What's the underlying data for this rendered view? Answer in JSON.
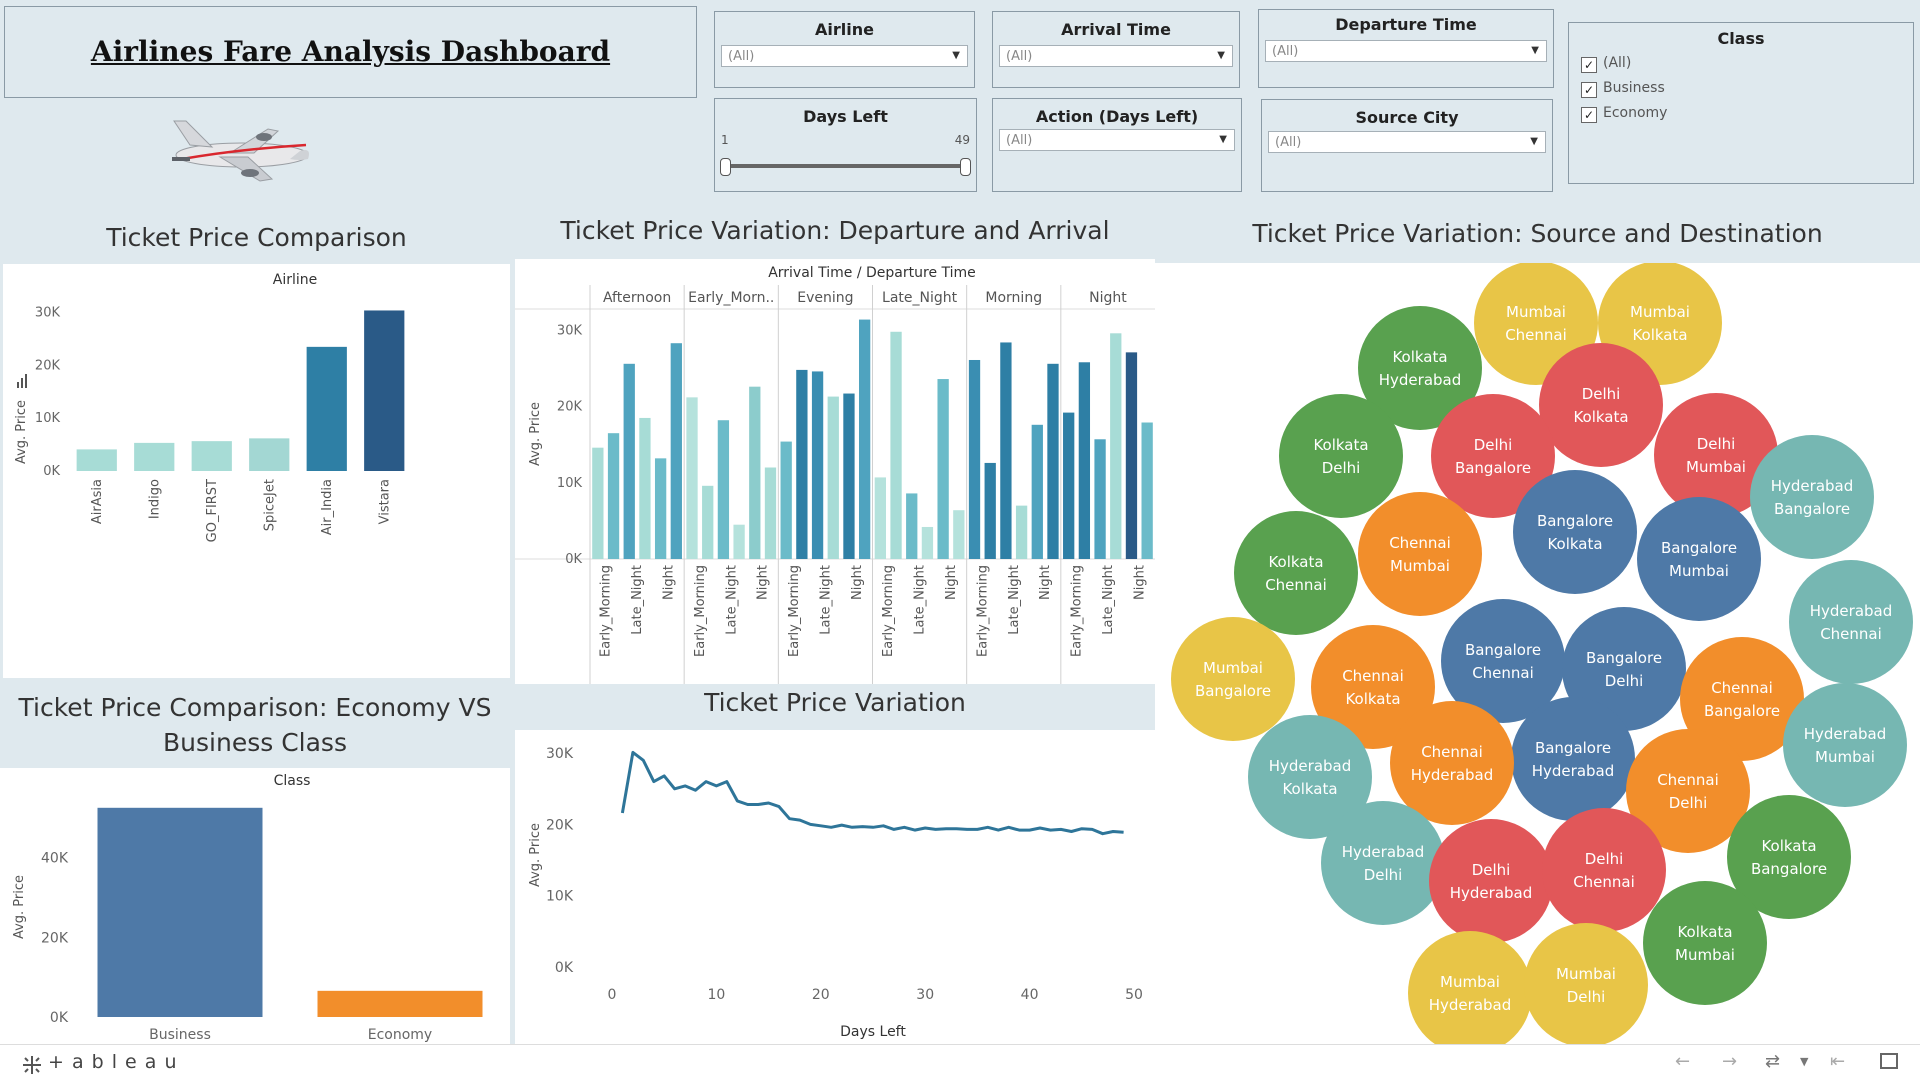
{
  "dashboard": {
    "title": "Airlines Fare Analysis Dashboard"
  },
  "filters": {
    "airline": {
      "label": "Airline",
      "value": "(All)"
    },
    "arrival_time": {
      "label": "Arrival Time",
      "value": "(All)"
    },
    "departure_time": {
      "label": "Departure Time",
      "value": "(All)"
    },
    "days_left": {
      "label": "Days Left",
      "min": "1",
      "max": "49"
    },
    "action_days_left": {
      "label": "Action (Days Left)",
      "value": "(All)"
    },
    "source_city": {
      "label": "Source City",
      "value": "(All)"
    },
    "class": {
      "label": "Class",
      "options": [
        "(All)",
        "Business",
        "Economy"
      ],
      "checked": [
        true,
        true,
        true
      ]
    }
  },
  "icons": {
    "airplane": "airplane-icon",
    "sort": "sort-icon",
    "tableau_logo": "tableau-logo"
  },
  "colors": {
    "background": "#dfe9ee",
    "business": "#4e79a7",
    "economy": "#f28e2b",
    "line": "#2e7599"
  },
  "chart_data": [
    {
      "id": "airline",
      "type": "bar",
      "title": "Ticket Price Comparison",
      "xlabel": "Airline",
      "ylabel": "Avg. Price",
      "categories": [
        "AirAsia",
        "Indigo",
        "GO_FIRST",
        "SpiceJet",
        "Air_India",
        "Vistara"
      ],
      "values": [
        4091,
        5324,
        5652,
        6179,
        23507,
        30397
      ],
      "colors": [
        "#a7dcd6",
        "#a7dcd6",
        "#a7dcd6",
        "#a3d7d3",
        "#2e7fa5",
        "#2a5a87"
      ],
      "yticks": [
        0,
        10000,
        20000,
        30000
      ],
      "ytick_labels": [
        "0K",
        "10K",
        "20K",
        "30K"
      ],
      "ylim": [
        0,
        32000
      ]
    },
    {
      "id": "dep_arr",
      "type": "bar",
      "title": "Ticket Price Variation: Departure and Arrival",
      "header": "Arrival Time / Departure Time",
      "ylabel": "Avg. Price",
      "groups": [
        "Afternoon",
        "Early_Morn..",
        "Evening",
        "Late_Night",
        "Morning",
        "Night"
      ],
      "subcategories": [
        [
          "Early_Morning",
          "Late_Night",
          "Night"
        ],
        [
          "Early_Morning",
          "Late_Night",
          "Night"
        ],
        [
          "Early_Morning",
          "Late_Night",
          "Night"
        ],
        [
          "Early_Morning",
          "Late_Night",
          "Night"
        ],
        [
          "Early_Morning",
          "Late_Night",
          "Night"
        ],
        [
          "Early_Morning",
          "Late_Night",
          "Night"
        ]
      ],
      "values": [
        [
          14600,
          16500,
          25600,
          18500,
          13200,
          28300
        ],
        [
          21200,
          9600,
          18200,
          4500,
          22600,
          12000
        ],
        [
          15400,
          24800,
          24600,
          21300,
          21700,
          31400
        ],
        [
          10700,
          29800,
          8600,
          4200,
          23600,
          6400
        ],
        [
          26100,
          12600,
          28400,
          7000,
          17600,
          25600
        ],
        [
          19200,
          25800,
          15700,
          29600,
          27100,
          17900
        ]
      ],
      "colors": [
        [
          "#a7dcd6",
          "#6bbbc9",
          "#4fa3bf",
          "#a7dcd6",
          "#6bbbc9",
          "#4fa3bf"
        ],
        [
          "#b5e2dc",
          "#a7dcd6",
          "#6bbbc9",
          "#b5e2dc",
          "#8ccccc",
          "#a7dcd6"
        ],
        [
          "#6bbbc9",
          "#2e7fa5",
          "#3a8eb2",
          "#a7dcd6",
          "#2e7fa5",
          "#4fa3bf"
        ],
        [
          "#b5e2dc",
          "#a7dcd6",
          "#6bbbc9",
          "#b5e2dc",
          "#6bbbc9",
          "#b5e2dc"
        ],
        [
          "#3a8eb2",
          "#2e7fa5",
          "#2e7fa5",
          "#a7dcd6",
          "#4fa3bf",
          "#2e7fa5"
        ],
        [
          "#2e7fa5",
          "#2e7fa5",
          "#4fa3bf",
          "#a7dcd6",
          "#2a5a87",
          "#6bbbc9"
        ]
      ],
      "yticks": [
        0,
        10000,
        20000,
        30000
      ],
      "ytick_labels": [
        "0K",
        "10K",
        "20K",
        "30K"
      ],
      "ylim": [
        0,
        32000
      ]
    },
    {
      "id": "class",
      "type": "bar",
      "title": "Ticket Price Comparison: Economy VS Business Class",
      "title_lines": [
        "Ticket Price Comparison: Economy VS",
        "Business Class"
      ],
      "xlabel": "Class",
      "ylabel": "Avg. Price",
      "categories": [
        "Business",
        "Economy"
      ],
      "values": [
        52540,
        6572
      ],
      "colors": [
        "#4e79a7",
        "#f28e2b"
      ],
      "yticks": [
        0,
        20000,
        40000
      ],
      "ytick_labels": [
        "0K",
        "20K",
        "40K"
      ],
      "ylim": [
        0,
        55000
      ]
    },
    {
      "id": "days",
      "type": "line",
      "title": "Ticket Price Variation",
      "xlabel": "Days Left",
      "ylabel": "Avg. Price",
      "x": [
        1,
        2,
        3,
        4,
        5,
        6,
        7,
        8,
        9,
        10,
        11,
        12,
        13,
        14,
        15,
        16,
        17,
        18,
        19,
        20,
        21,
        22,
        23,
        24,
        25,
        26,
        27,
        28,
        29,
        30,
        31,
        32,
        33,
        34,
        35,
        36,
        37,
        38,
        39,
        40,
        41,
        42,
        43,
        44,
        45,
        46,
        47,
        48,
        49
      ],
      "y": [
        21600,
        30100,
        29000,
        26000,
        26800,
        25000,
        25400,
        24800,
        26000,
        25400,
        26000,
        23300,
        22800,
        22800,
        23000,
        22500,
        20800,
        20600,
        20000,
        19800,
        19600,
        19900,
        19600,
        19700,
        19600,
        19800,
        19300,
        19600,
        19200,
        19500,
        19300,
        19400,
        19400,
        19300,
        19300,
        19600,
        19200,
        19600,
        19200,
        19200,
        19500,
        19200,
        19300,
        19000,
        19400,
        19300,
        18700,
        19000,
        18900
      ],
      "xticks": [
        0,
        10,
        20,
        30,
        40,
        50
      ],
      "yticks": [
        0,
        10000,
        20000,
        30000
      ],
      "ytick_labels": [
        "0K",
        "10K",
        "20K",
        "30K"
      ],
      "xlim": [
        0,
        50
      ],
      "ylim": [
        0,
        31000
      ]
    },
    {
      "id": "routes",
      "type": "bubble",
      "title": "Ticket Price Variation: Source and Destination",
      "bubbles": [
        {
          "source": "Mumbai",
          "dest": "Chennai",
          "color": "#e8c547"
        },
        {
          "source": "Mumbai",
          "dest": "Kolkata",
          "color": "#e8c547"
        },
        {
          "source": "Kolkata",
          "dest": "Hyderabad",
          "color": "#59a14f"
        },
        {
          "source": "Delhi",
          "dest": "Kolkata",
          "color": "#e15759"
        },
        {
          "source": "Kolkata",
          "dest": "Delhi",
          "color": "#59a14f"
        },
        {
          "source": "Delhi",
          "dest": "Bangalore",
          "color": "#e15759"
        },
        {
          "source": "Delhi",
          "dest": "Mumbai",
          "color": "#e15759"
        },
        {
          "source": "Hyderabad",
          "dest": "Bangalore",
          "color": "#76b7b2"
        },
        {
          "source": "Bangalore",
          "dest": "Kolkata",
          "color": "#4e79a7"
        },
        {
          "source": "Chennai",
          "dest": "Mumbai",
          "color": "#f28e2b"
        },
        {
          "source": "Bangalore",
          "dest": "Mumbai",
          "color": "#4e79a7"
        },
        {
          "source": "Kolkata",
          "dest": "Chennai",
          "color": "#59a14f"
        },
        {
          "source": "Hyderabad",
          "dest": "Chennai",
          "color": "#76b7b2"
        },
        {
          "source": "Bangalore",
          "dest": "Chennai",
          "color": "#4e79a7"
        },
        {
          "source": "Bangalore",
          "dest": "Delhi",
          "color": "#4e79a7"
        },
        {
          "source": "Chennai",
          "dest": "Kolkata",
          "color": "#f28e2b"
        },
        {
          "source": "Mumbai",
          "dest": "Bangalore",
          "color": "#e8c547"
        },
        {
          "source": "Chennai",
          "dest": "Bangalore",
          "color": "#f28e2b"
        },
        {
          "source": "Hyderabad",
          "dest": "Mumbai",
          "color": "#76b7b2"
        },
        {
          "source": "Bangalore",
          "dest": "Hyderabad",
          "color": "#4e79a7"
        },
        {
          "source": "Chennai",
          "dest": "Hyderabad",
          "color": "#f28e2b"
        },
        {
          "source": "Hyderabad",
          "dest": "Kolkata",
          "color": "#76b7b2"
        },
        {
          "source": "Chennai",
          "dest": "Delhi",
          "color": "#f28e2b"
        },
        {
          "source": "Kolkata",
          "dest": "Bangalore",
          "color": "#59a14f"
        },
        {
          "source": "Hyderabad",
          "dest": "Delhi",
          "color": "#76b7b2"
        },
        {
          "source": "Delhi",
          "dest": "Hyderabad",
          "color": "#e15759"
        },
        {
          "source": "Delhi",
          "dest": "Chennai",
          "color": "#e15759"
        },
        {
          "source": "Kolkata",
          "dest": "Mumbai",
          "color": "#59a14f"
        },
        {
          "source": "Mumbai",
          "dest": "Hyderabad",
          "color": "#e8c547"
        },
        {
          "source": "Mumbai",
          "dest": "Delhi",
          "color": "#e8c547"
        }
      ]
    }
  ],
  "footer": {
    "brand": "+ a b l e a u"
  }
}
